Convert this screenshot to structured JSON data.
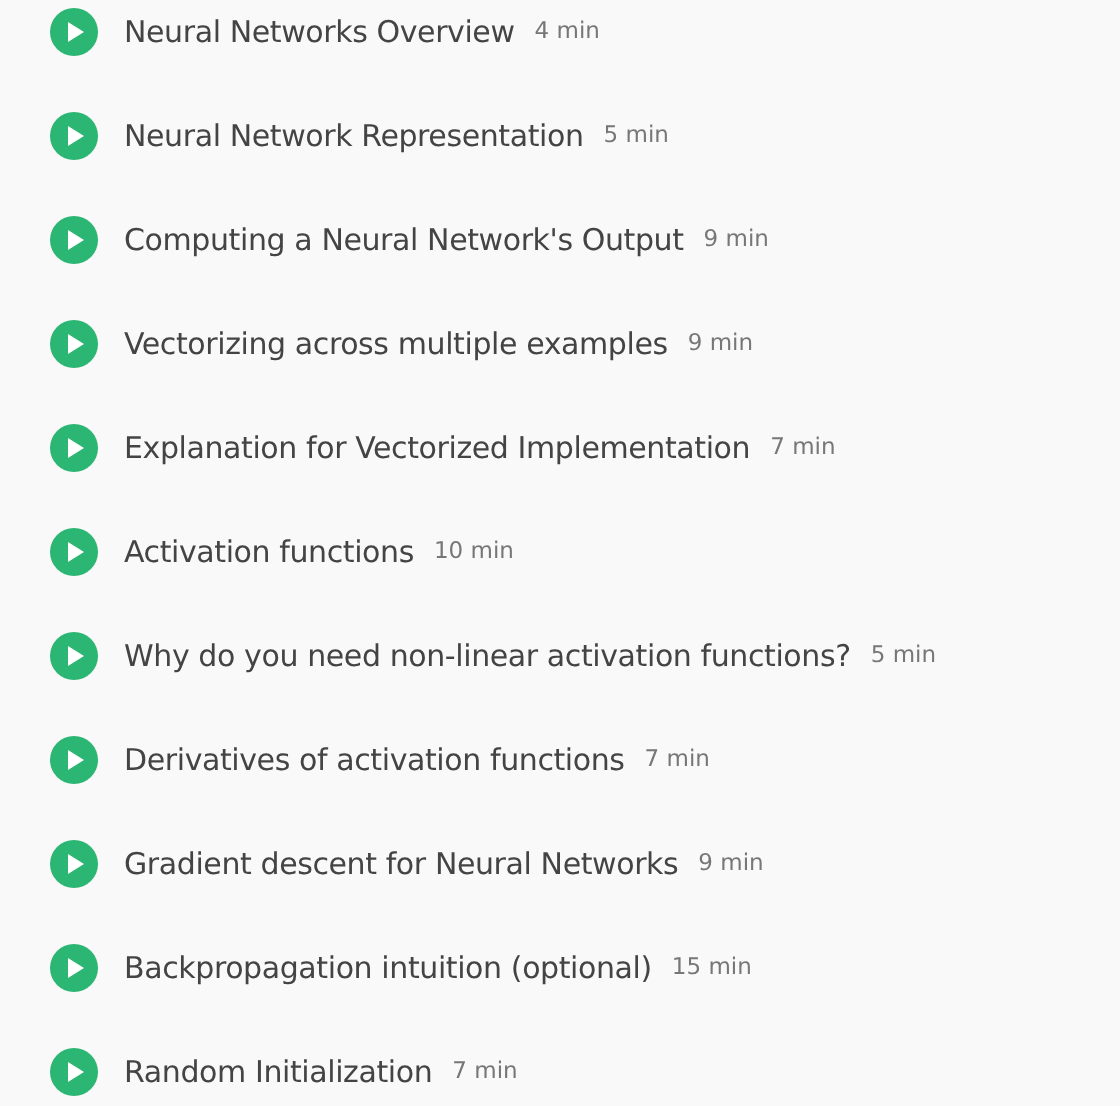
{
  "lectures": [
    {
      "title": "Neural Networks Overview",
      "duration": "4 min"
    },
    {
      "title": "Neural Network Representation",
      "duration": "5 min"
    },
    {
      "title": "Computing a Neural Network's Output",
      "duration": "9 min"
    },
    {
      "title": "Vectorizing across multiple examples",
      "duration": "9 min"
    },
    {
      "title": "Explanation for Vectorized Implementation",
      "duration": "7 min"
    },
    {
      "title": "Activation functions",
      "duration": "10 min"
    },
    {
      "title": "Why do you need non-linear activation functions?",
      "duration": "5 min"
    },
    {
      "title": "Derivatives of activation functions",
      "duration": "7 min"
    },
    {
      "title": "Gradient descent for Neural Networks",
      "duration": "9 min"
    },
    {
      "title": "Backpropagation intuition (optional)",
      "duration": "15 min"
    },
    {
      "title": "Random Initialization",
      "duration": "7 min"
    }
  ]
}
